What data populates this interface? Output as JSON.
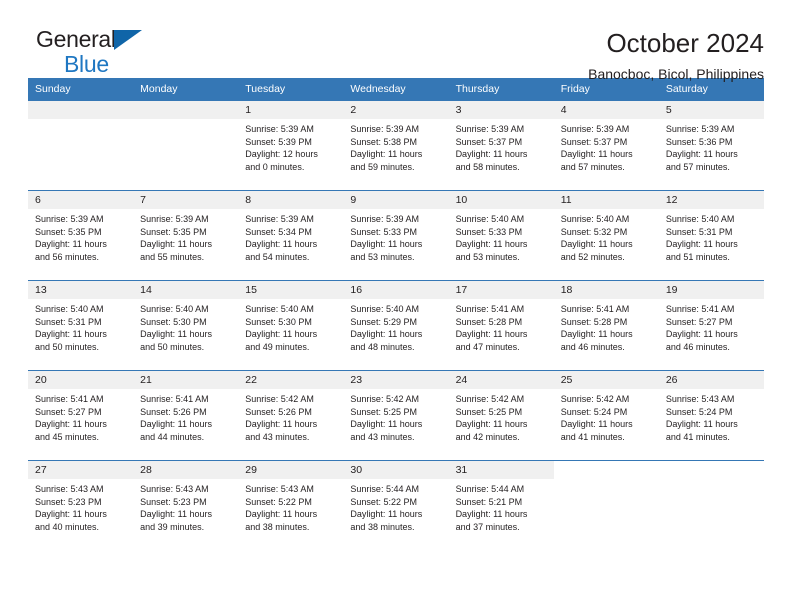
{
  "logo": {
    "word1": "General",
    "word2": "Blue",
    "accent_color": "#1065a8"
  },
  "header": {
    "title": "October 2024",
    "subtitle": "Banocboc, Bicol, Philippines"
  },
  "colors": {
    "header_row": "#3577b5",
    "daynum_band": "#f0f0f0",
    "text": "#231f20"
  },
  "weekdays": [
    "Sunday",
    "Monday",
    "Tuesday",
    "Wednesday",
    "Thursday",
    "Friday",
    "Saturday"
  ],
  "weeks": [
    [
      {
        "day": "",
        "lines": []
      },
      {
        "day": "",
        "lines": []
      },
      {
        "day": "1",
        "lines": [
          "Sunrise: 5:39 AM",
          "Sunset: 5:39 PM",
          "Daylight: 12 hours",
          "and 0 minutes."
        ]
      },
      {
        "day": "2",
        "lines": [
          "Sunrise: 5:39 AM",
          "Sunset: 5:38 PM",
          "Daylight: 11 hours",
          "and 59 minutes."
        ]
      },
      {
        "day": "3",
        "lines": [
          "Sunrise: 5:39 AM",
          "Sunset: 5:37 PM",
          "Daylight: 11 hours",
          "and 58 minutes."
        ]
      },
      {
        "day": "4",
        "lines": [
          "Sunrise: 5:39 AM",
          "Sunset: 5:37 PM",
          "Daylight: 11 hours",
          "and 57 minutes."
        ]
      },
      {
        "day": "5",
        "lines": [
          "Sunrise: 5:39 AM",
          "Sunset: 5:36 PM",
          "Daylight: 11 hours",
          "and 57 minutes."
        ]
      }
    ],
    [
      {
        "day": "6",
        "lines": [
          "Sunrise: 5:39 AM",
          "Sunset: 5:35 PM",
          "Daylight: 11 hours",
          "and 56 minutes."
        ]
      },
      {
        "day": "7",
        "lines": [
          "Sunrise: 5:39 AM",
          "Sunset: 5:35 PM",
          "Daylight: 11 hours",
          "and 55 minutes."
        ]
      },
      {
        "day": "8",
        "lines": [
          "Sunrise: 5:39 AM",
          "Sunset: 5:34 PM",
          "Daylight: 11 hours",
          "and 54 minutes."
        ]
      },
      {
        "day": "9",
        "lines": [
          "Sunrise: 5:39 AM",
          "Sunset: 5:33 PM",
          "Daylight: 11 hours",
          "and 53 minutes."
        ]
      },
      {
        "day": "10",
        "lines": [
          "Sunrise: 5:40 AM",
          "Sunset: 5:33 PM",
          "Daylight: 11 hours",
          "and 53 minutes."
        ]
      },
      {
        "day": "11",
        "lines": [
          "Sunrise: 5:40 AM",
          "Sunset: 5:32 PM",
          "Daylight: 11 hours",
          "and 52 minutes."
        ]
      },
      {
        "day": "12",
        "lines": [
          "Sunrise: 5:40 AM",
          "Sunset: 5:31 PM",
          "Daylight: 11 hours",
          "and 51 minutes."
        ]
      }
    ],
    [
      {
        "day": "13",
        "lines": [
          "Sunrise: 5:40 AM",
          "Sunset: 5:31 PM",
          "Daylight: 11 hours",
          "and 50 minutes."
        ]
      },
      {
        "day": "14",
        "lines": [
          "Sunrise: 5:40 AM",
          "Sunset: 5:30 PM",
          "Daylight: 11 hours",
          "and 50 minutes."
        ]
      },
      {
        "day": "15",
        "lines": [
          "Sunrise: 5:40 AM",
          "Sunset: 5:30 PM",
          "Daylight: 11 hours",
          "and 49 minutes."
        ]
      },
      {
        "day": "16",
        "lines": [
          "Sunrise: 5:40 AM",
          "Sunset: 5:29 PM",
          "Daylight: 11 hours",
          "and 48 minutes."
        ]
      },
      {
        "day": "17",
        "lines": [
          "Sunrise: 5:41 AM",
          "Sunset: 5:28 PM",
          "Daylight: 11 hours",
          "and 47 minutes."
        ]
      },
      {
        "day": "18",
        "lines": [
          "Sunrise: 5:41 AM",
          "Sunset: 5:28 PM",
          "Daylight: 11 hours",
          "and 46 minutes."
        ]
      },
      {
        "day": "19",
        "lines": [
          "Sunrise: 5:41 AM",
          "Sunset: 5:27 PM",
          "Daylight: 11 hours",
          "and 46 minutes."
        ]
      }
    ],
    [
      {
        "day": "20",
        "lines": [
          "Sunrise: 5:41 AM",
          "Sunset: 5:27 PM",
          "Daylight: 11 hours",
          "and 45 minutes."
        ]
      },
      {
        "day": "21",
        "lines": [
          "Sunrise: 5:41 AM",
          "Sunset: 5:26 PM",
          "Daylight: 11 hours",
          "and 44 minutes."
        ]
      },
      {
        "day": "22",
        "lines": [
          "Sunrise: 5:42 AM",
          "Sunset: 5:26 PM",
          "Daylight: 11 hours",
          "and 43 minutes."
        ]
      },
      {
        "day": "23",
        "lines": [
          "Sunrise: 5:42 AM",
          "Sunset: 5:25 PM",
          "Daylight: 11 hours",
          "and 43 minutes."
        ]
      },
      {
        "day": "24",
        "lines": [
          "Sunrise: 5:42 AM",
          "Sunset: 5:25 PM",
          "Daylight: 11 hours",
          "and 42 minutes."
        ]
      },
      {
        "day": "25",
        "lines": [
          "Sunrise: 5:42 AM",
          "Sunset: 5:24 PM",
          "Daylight: 11 hours",
          "and 41 minutes."
        ]
      },
      {
        "day": "26",
        "lines": [
          "Sunrise: 5:43 AM",
          "Sunset: 5:24 PM",
          "Daylight: 11 hours",
          "and 41 minutes."
        ]
      }
    ],
    [
      {
        "day": "27",
        "lines": [
          "Sunrise: 5:43 AM",
          "Sunset: 5:23 PM",
          "Daylight: 11 hours",
          "and 40 minutes."
        ]
      },
      {
        "day": "28",
        "lines": [
          "Sunrise: 5:43 AM",
          "Sunset: 5:23 PM",
          "Daylight: 11 hours",
          "and 39 minutes."
        ]
      },
      {
        "day": "29",
        "lines": [
          "Sunrise: 5:43 AM",
          "Sunset: 5:22 PM",
          "Daylight: 11 hours",
          "and 38 minutes."
        ]
      },
      {
        "day": "30",
        "lines": [
          "Sunrise: 5:44 AM",
          "Sunset: 5:22 PM",
          "Daylight: 11 hours",
          "and 38 minutes."
        ]
      },
      {
        "day": "31",
        "lines": [
          "Sunrise: 5:44 AM",
          "Sunset: 5:21 PM",
          "Daylight: 11 hours",
          "and 37 minutes."
        ]
      },
      {
        "day": "",
        "lines": []
      },
      {
        "day": "",
        "lines": []
      }
    ]
  ]
}
